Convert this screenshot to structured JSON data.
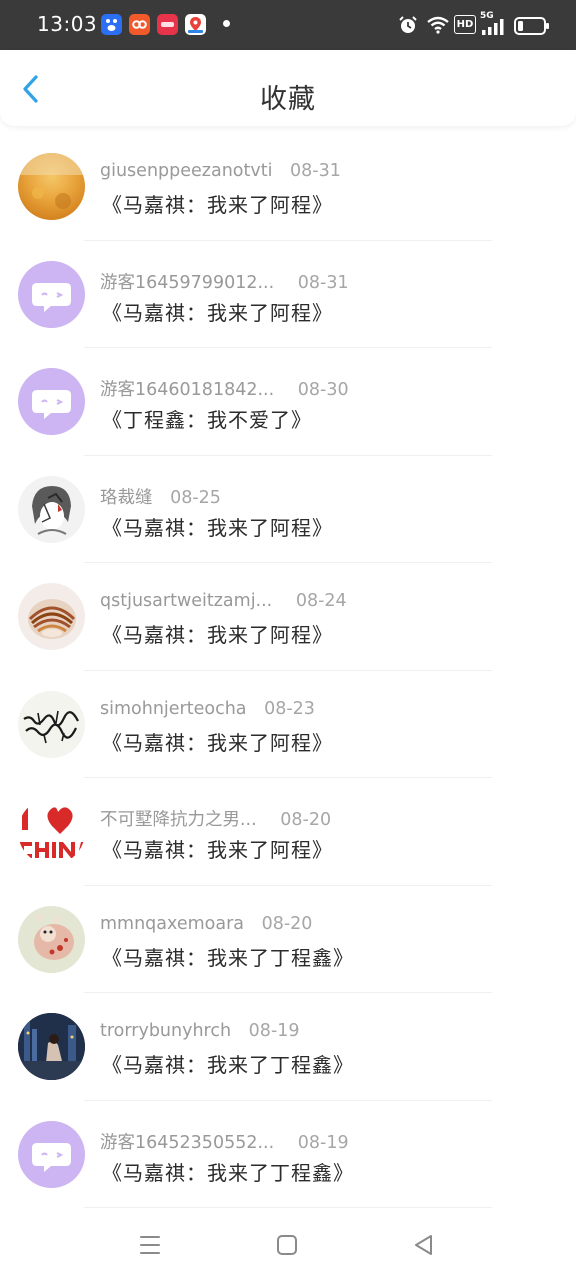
{
  "status_bar": {
    "time": "13:03",
    "app_icons": [
      "baidu-app-icon",
      "meituan-app-icon",
      "weibo-app-icon",
      "maps-app-icon"
    ],
    "indicators": [
      "alarm-icon",
      "wifi-icon",
      "hd-icon",
      "5g-signal-icon",
      "battery-icon"
    ],
    "hd_label": "HD",
    "net_label": "5G"
  },
  "header": {
    "title": "收藏",
    "back_icon": "back-chevron-icon",
    "accent_color": "#2fa3e6"
  },
  "favorites": [
    {
      "user": "giusenppeezanotvti",
      "date": "08-31",
      "title": "《马嘉祺：我来了阿程》",
      "avatar": "autumn-leaves-photo"
    },
    {
      "user": "游客16459799012...",
      "date": "08-31",
      "title": "《马嘉祺：我来了阿程》",
      "avatar": "default-chat-avatar"
    },
    {
      "user": "游客16460181842...",
      "date": "08-30",
      "title": "《丁程鑫：我不爱了》",
      "avatar": "default-chat-avatar"
    },
    {
      "user": "珞裁缝",
      "date": "08-25",
      "title": "《马嘉祺：我来了阿程》",
      "avatar": "anime-sketch-photo"
    },
    {
      "user": "qstjusartweitzamj...",
      "date": "08-24",
      "title": "《马嘉祺：我来了阿程》",
      "avatar": "seashell-photo"
    },
    {
      "user": "simohnjerteocha",
      "date": "08-23",
      "title": "《马嘉祺：我来了阿程》",
      "avatar": "calligraphy-photo"
    },
    {
      "user": "不可墅降抗力之男...",
      "date": "08-20",
      "title": "《马嘉祺：我来了阿程》",
      "avatar": "i-love-china-photo"
    },
    {
      "user": "mmnqaxemoara",
      "date": "08-20",
      "title": "《马嘉祺：我来了丁程鑫》",
      "avatar": "plush-toy-photo"
    },
    {
      "user": "trorrybunyhrch",
      "date": "08-19",
      "title": "《马嘉祺：我来了丁程鑫》",
      "avatar": "night-city-photo"
    },
    {
      "user": "游客16452350552...",
      "date": "08-19",
      "title": "《马嘉祺：我来了丁程鑫》",
      "avatar": "default-chat-avatar"
    }
  ],
  "nav_bar": {
    "buttons": [
      "menu-icon",
      "home-square-icon",
      "back-triangle-icon"
    ]
  },
  "colors": {
    "default_avatar_bg": "#cdb4f2",
    "text_primary": "#2b2b2b",
    "text_secondary": "#999999"
  }
}
